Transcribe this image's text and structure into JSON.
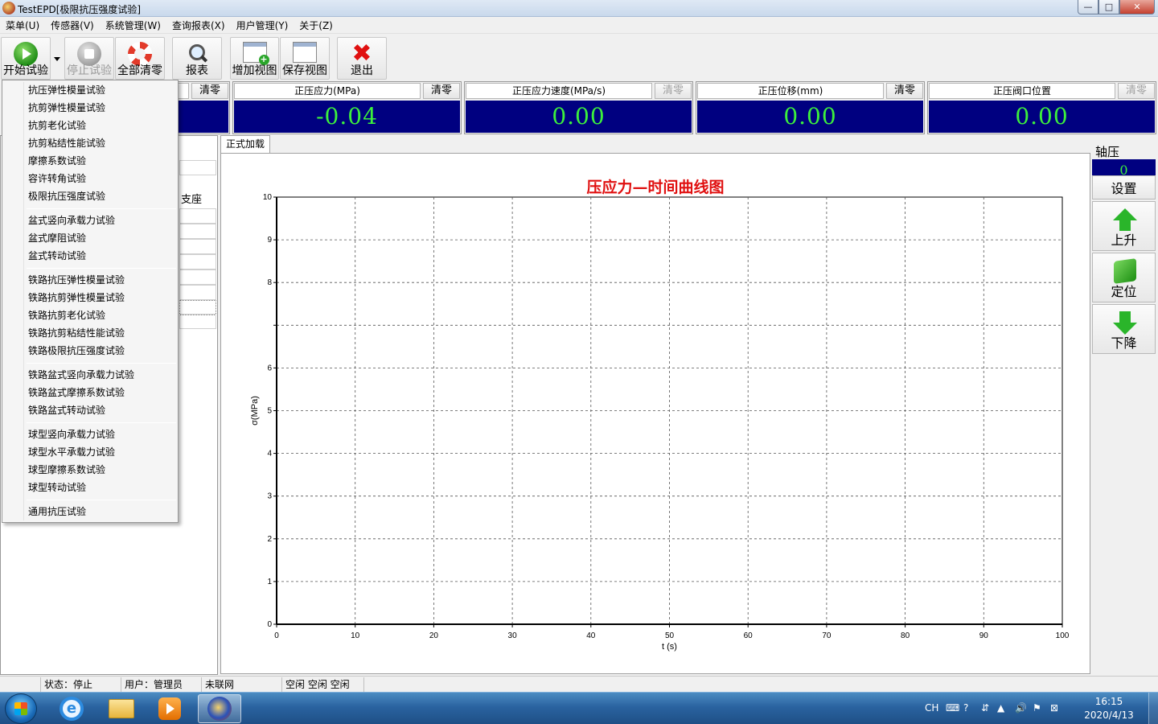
{
  "window": {
    "title": "TestEPD[极限抗压强度试验]",
    "minimize": "—",
    "maximize": "□",
    "close": "✕"
  },
  "menubar": [
    "菜单(U)",
    "传感器(V)",
    "系统管理(W)",
    "查询报表(X)",
    "用户管理(Y)",
    "关于(Z)"
  ],
  "toolbar": {
    "start": "开始试验",
    "stop": "停止试验",
    "zero_all": "全部清零",
    "report": "报表",
    "add_view": "增加视图",
    "save_view": "保存视图",
    "exit": "退出"
  },
  "readouts": [
    {
      "label": "",
      "zero": "清零",
      "value": ""
    },
    {
      "label": "正压应力(MPa)",
      "zero": "清零",
      "value": "-0.04"
    },
    {
      "label": "正压应力速度(MPa/s)",
      "zero": "清零",
      "value": "0.00",
      "zero_disabled": true
    },
    {
      "label": "正压位移(mm)",
      "zero": "清零",
      "value": "0.00"
    },
    {
      "label": "正压阀口位置",
      "zero": "清零",
      "value": "0.00",
      "zero_disabled": true
    }
  ],
  "left_panel": {
    "partial_text": "支座"
  },
  "dropdown": {
    "group1": [
      "抗压弹性模量试验",
      "抗剪弹性模量试验",
      "抗剪老化试验",
      "抗剪粘结性能试验",
      "摩擦系数试验",
      "容许转角试验",
      "极限抗压强度试验"
    ],
    "group2": [
      "盆式竖向承载力试验",
      "盆式摩阻试验",
      "盆式转动试验"
    ],
    "group3": [
      "铁路抗压弹性模量试验",
      "铁路抗剪弹性模量试验",
      "铁路抗剪老化试验",
      "铁路抗剪粘结性能试验",
      "铁路极限抗压强度试验"
    ],
    "group4": [
      "铁路盆式竖向承载力试验",
      "铁路盆式摩擦系数试验",
      "铁路盆式转动试验"
    ],
    "group5": [
      "球型竖向承载力试验",
      "球型水平承载力试验",
      "球型摩擦系数试验",
      "球型转动试验"
    ],
    "group6": [
      "通用抗压试验"
    ]
  },
  "tabs": {
    "formal_loading": "正式加载"
  },
  "chart_data": {
    "type": "line",
    "title": "压应力—时间曲线图",
    "xlabel": "t (s)",
    "ylabel": "σ(MPa)",
    "xlim": [
      0,
      100
    ],
    "ylim": [
      0,
      10
    ],
    "x_ticks": [
      0,
      10,
      20,
      30,
      40,
      50,
      60,
      70,
      80,
      90,
      100
    ],
    "y_ticks": [
      0,
      1,
      2,
      3,
      4,
      5,
      6,
      8,
      9,
      10
    ],
    "grid": true,
    "series": []
  },
  "right_panel": {
    "axial_label": "轴压",
    "axial_value": "0",
    "set": "设置",
    "up": "上升",
    "position": "定位",
    "down": "下降"
  },
  "statusbar": {
    "state": "状态：停止",
    "user": "用户：管理员",
    "network": "未联网",
    "idle": "空闲 空闲 空闲"
  },
  "taskbar": {
    "lang": "CH",
    "time": "16:15",
    "date": "2020/4/13"
  }
}
